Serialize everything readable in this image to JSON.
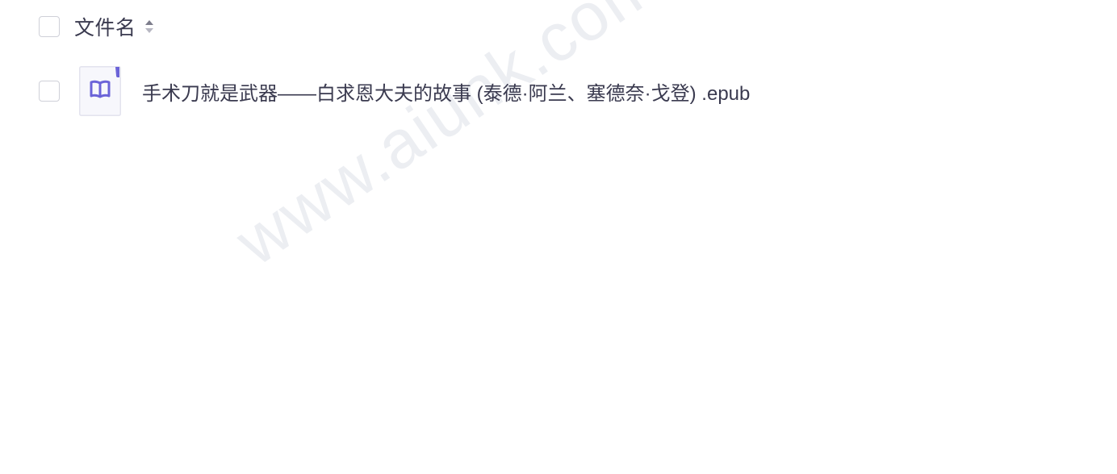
{
  "header": {
    "column_label": "文件名",
    "sort_icon": "sort-updown-icon"
  },
  "files": [
    {
      "name": "手术刀就是武器——白求恩大夫的故事 (泰德·阿兰、塞德奈·戈登) .epub",
      "icon": "epub-book-icon"
    }
  ],
  "watermark": "www.aiunk.com",
  "colors": {
    "text": "#3a3a4f",
    "checkbox_border": "#cfd0d8",
    "icon_accent": "#6b63d8",
    "watermark": "#eceef2"
  }
}
